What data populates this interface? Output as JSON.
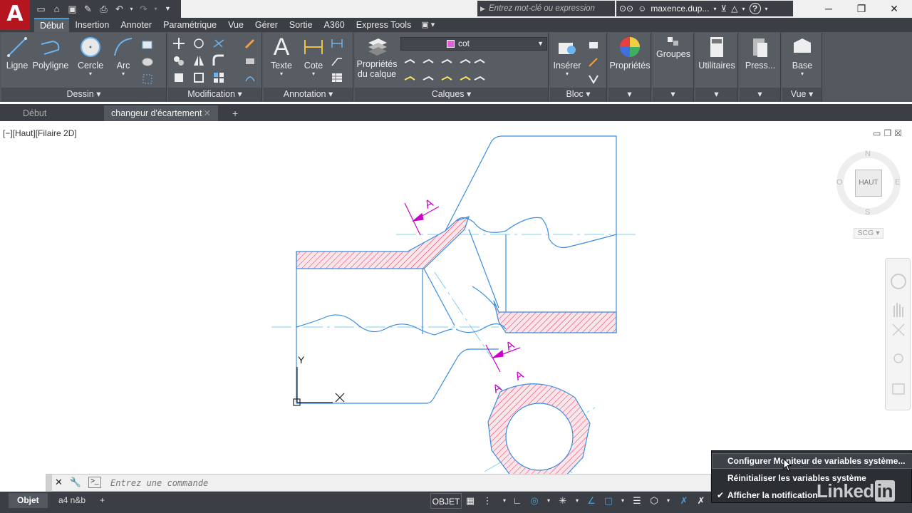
{
  "app": {
    "logo_letter": "A"
  },
  "title_bar": {
    "search_placeholder": "Entrez mot-clé ou expression",
    "user_name": "maxence.dup...",
    "help_label": "?"
  },
  "ribbon_tabs": [
    "Début",
    "Insertion",
    "Annoter",
    "Paramétrique",
    "Vue",
    "Gérer",
    "Sortie",
    "A360",
    "Express Tools"
  ],
  "ribbon": {
    "panels": {
      "dessin": {
        "title": "Dessin ▾",
        "buttons": [
          "Ligne",
          "Polyligne",
          "Cercle",
          "Arc"
        ]
      },
      "modification": {
        "title": "Modification ▾"
      },
      "annotation": {
        "title": "Annotation ▾",
        "buttons": [
          "Texte",
          "Cote"
        ]
      },
      "calques": {
        "title": "Calques ▾",
        "props_line1": "Propriétés",
        "props_line2": "du calque",
        "current_layer": "cot"
      },
      "bloc": {
        "title": "Bloc ▾",
        "insert_label": "Insérer"
      },
      "proprietes": {
        "label": "Propriétés"
      },
      "groupes": {
        "label": "Groupes"
      },
      "utilitaires": {
        "label": "Utilitaires"
      },
      "presse": {
        "label": "Press..."
      },
      "base": {
        "label": "Base",
        "view_title": "Vue ▾"
      }
    }
  },
  "file_tabs": {
    "start": "Début",
    "drawing": "changeur d'écartement"
  },
  "viewport": {
    "label": "[−][Haut][Filaire 2D]",
    "ucs_y": "Y",
    "ucs_x": "X",
    "section_label": "A"
  },
  "viewcube": {
    "north": "N",
    "south": "S",
    "east": "E",
    "west": "O",
    "face": "HAUT",
    "wcs": "SCG"
  },
  "command_line": {
    "placeholder": "Entrez une commande"
  },
  "status_bar": {
    "model_tab": "Objet",
    "layout_tab": "a4 n&b",
    "add_tab": "+",
    "space_label": "OBJET"
  },
  "context_menu": {
    "items": [
      {
        "label": "Configurer Moniteur de variables système...",
        "checked": false
      },
      {
        "label": "Réinitialiser les variables système",
        "checked": false
      },
      {
        "label": "Afficher la notification",
        "checked": true
      }
    ]
  },
  "watermark": {
    "text": "Linked",
    "badge": "in"
  },
  "colors": {
    "ribbon_bg": "#53575e",
    "dark_bar": "#3b3f45",
    "logo_red": "#b4151f",
    "geometry_blue": "#3a8ee0",
    "center_line": "#7fd0e8",
    "hatch_red": "#e03050",
    "dimension_magenta": "#cc00cc"
  }
}
